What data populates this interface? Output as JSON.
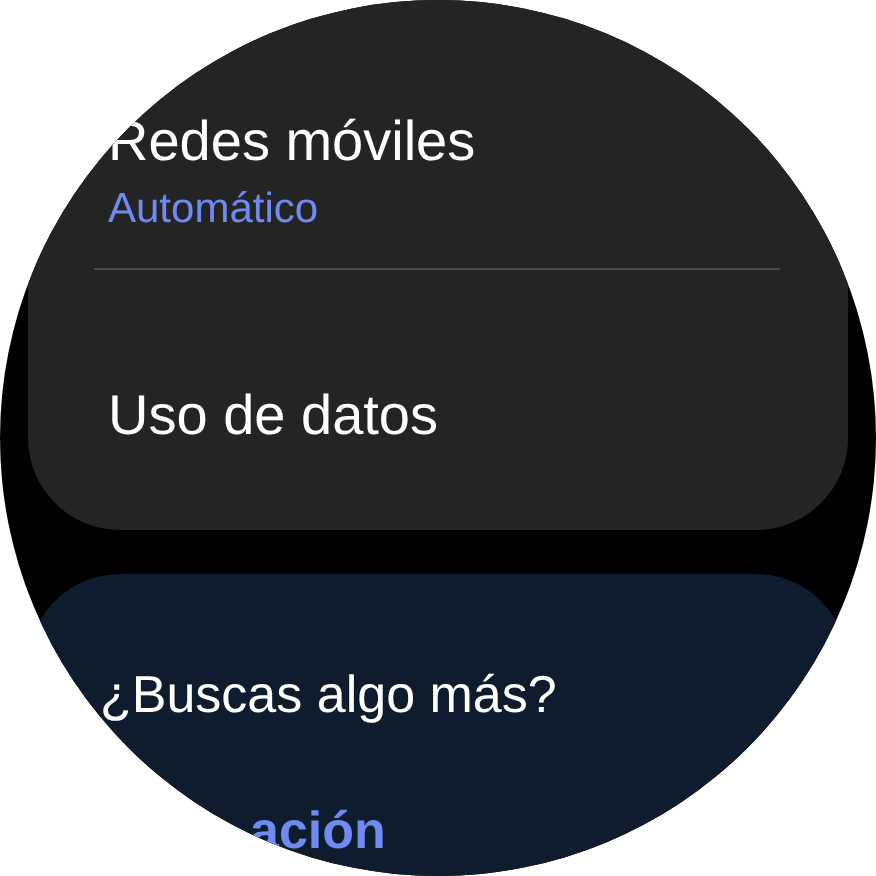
{
  "connections_card": {
    "items": [
      {
        "title": "Redes móviles",
        "subtitle": "Automático"
      },
      {
        "title": "Uso de datos"
      }
    ]
  },
  "more_card": {
    "title": "¿Buscas algo más?",
    "link": "ación"
  }
}
